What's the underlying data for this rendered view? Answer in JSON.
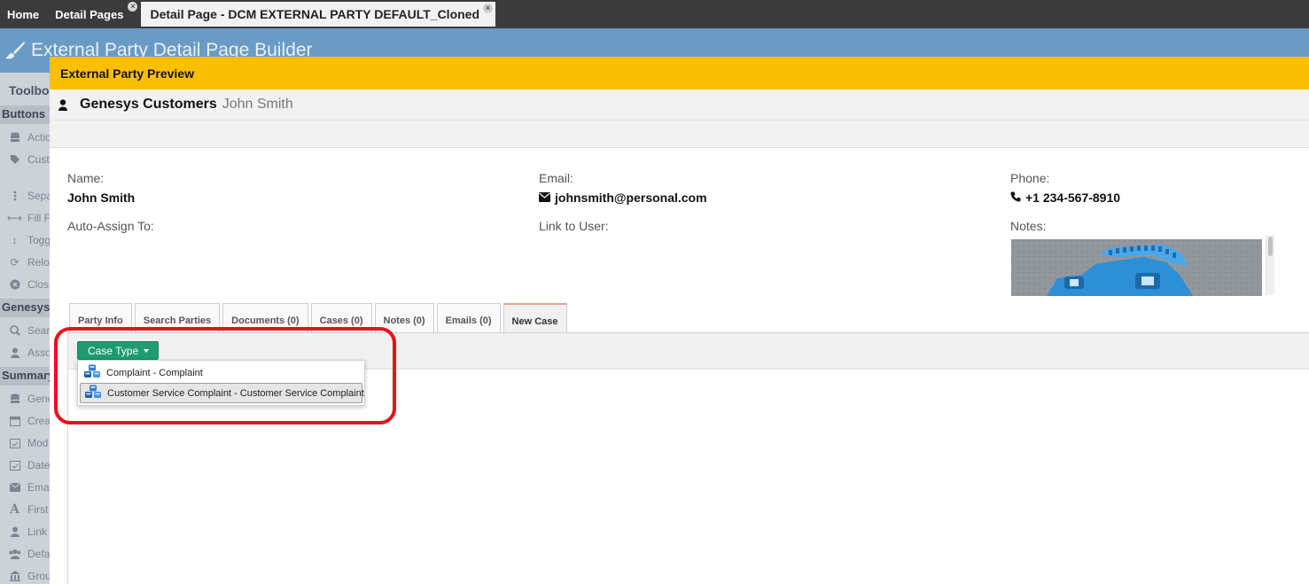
{
  "top_tabs": {
    "home": "Home",
    "detail_pages": "Detail Pages",
    "active": "Detail Page - DCM EXTERNAL PARTY DEFAULT_Cloned"
  },
  "builder": {
    "title": "External Party Detail Page Builder"
  },
  "toolbox": {
    "title": "Toolbo",
    "sections": {
      "buttons": "Buttons",
      "genesys": "Genesys",
      "summary": "Summary"
    },
    "items": {
      "action": "Actio",
      "custom": "Cust",
      "separator": "Sepa",
      "fill": "Fill F",
      "toggle": "Togg",
      "reload": "Relo",
      "close": "Clos",
      "search": "Sear",
      "associate": "Asso",
      "general": "Gene",
      "created": "Crea",
      "modified": "Mod",
      "date": "Date",
      "email": "Ema",
      "first": "First",
      "link": "Link",
      "default": "Defa",
      "group": "Grou"
    }
  },
  "preview": {
    "header": "External Party Preview",
    "party_type": "Genesys Customers",
    "party_name": "John Smith",
    "fields": {
      "name_label": "Name:",
      "name_value": "John Smith",
      "email_label": "Email:",
      "email_value": "johnsmith@personal.com",
      "phone_label": "Phone:",
      "phone_value": "+1 234-567-8910",
      "auto_assign_label": "Auto-Assign To:",
      "link_user_label": "Link to User:",
      "notes_label": "Notes:"
    },
    "tabs": {
      "party_info": "Party Info",
      "search_parties": "Search Parties",
      "documents": "Documents (0)",
      "cases": "Cases (0)",
      "notes": "Notes (0)",
      "emails": "Emails (0)",
      "new_case": "New Case"
    },
    "case_type_button": "Case Type",
    "case_type_options": {
      "complaint": "Complaint - Complaint",
      "customer_service_complaint": "Customer Service Complaint - Customer Service Complaint"
    }
  },
  "colors": {
    "preview_header": "#fbbf00",
    "builder_header": "#6a9bc6",
    "case_type_button": "#1f9b72",
    "highlight": "#e8121b"
  }
}
